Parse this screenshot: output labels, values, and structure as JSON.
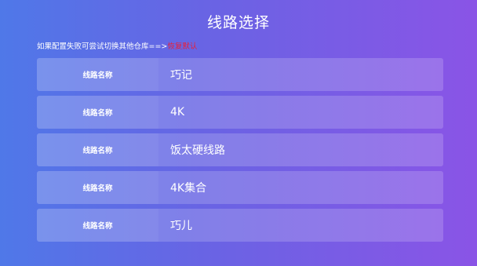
{
  "header": {
    "title": "线路选择"
  },
  "hint": {
    "text": "如果配置失败可尝试切换其他仓库==>",
    "restore_label": "恢复默认"
  },
  "lines": [
    {
      "label": "线路名称",
      "value": "巧记"
    },
    {
      "label": "线路名称",
      "value": "4K"
    },
    {
      "label": "线路名称",
      "value": "饭太硬线路"
    },
    {
      "label": "线路名称",
      "value": "4K集合"
    },
    {
      "label": "线路名称",
      "value": "巧儿"
    }
  ]
}
